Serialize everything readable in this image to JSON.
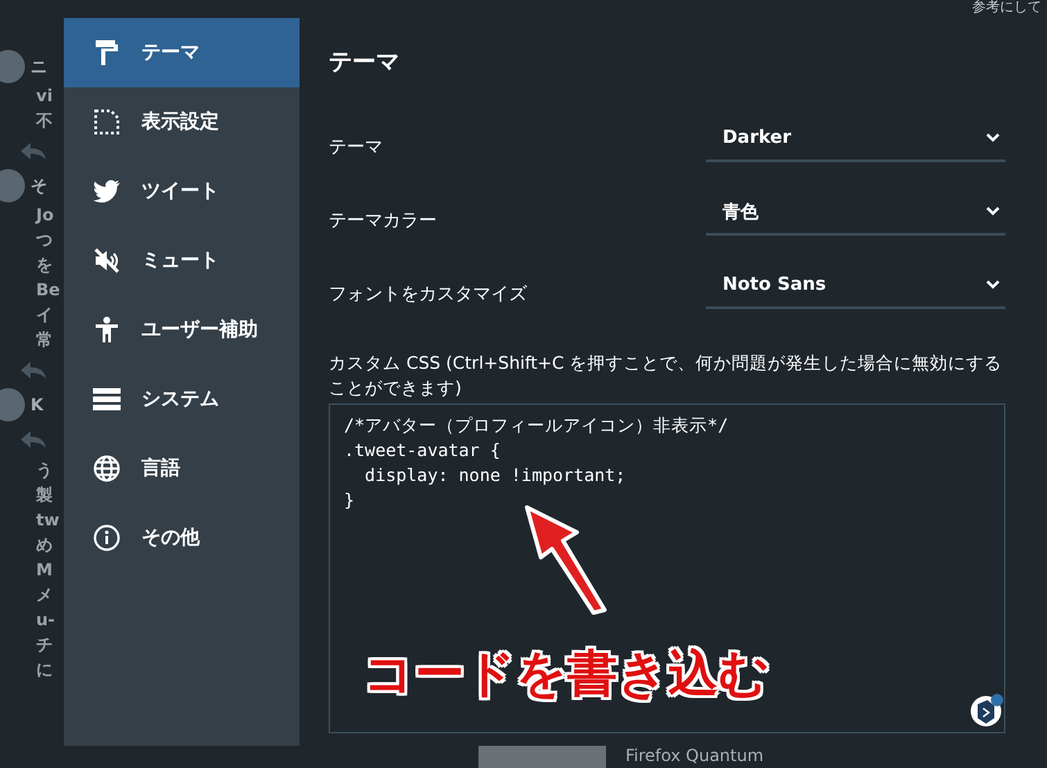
{
  "background": {
    "left_fragments": [
      {
        "kind": "gap"
      },
      {
        "kind": "name",
        "text": "ニ"
      },
      {
        "kind": "text",
        "text": "vi"
      },
      {
        "kind": "text",
        "text": "不"
      },
      {
        "kind": "reply"
      },
      {
        "kind": "name",
        "text": "そ"
      },
      {
        "kind": "text",
        "text": "Jo"
      },
      {
        "kind": "text",
        "text": "つ"
      },
      {
        "kind": "text",
        "text": "を"
      },
      {
        "kind": "text",
        "text": "Be"
      },
      {
        "kind": "text",
        "text": "イ"
      },
      {
        "kind": "text",
        "text": "常"
      },
      {
        "kind": "reply"
      },
      {
        "kind": "name",
        "text": "K"
      },
      {
        "kind": "reply"
      },
      {
        "kind": "text",
        "text": "う"
      },
      {
        "kind": "text",
        "text": "製"
      },
      {
        "kind": "text",
        "text": "tw"
      },
      {
        "kind": "text",
        "text": "め"
      },
      {
        "kind": "text",
        "text": "M"
      },
      {
        "kind": "text",
        "text": "メ"
      },
      {
        "kind": "text",
        "text": "u-"
      },
      {
        "kind": "text",
        "text": "チ"
      },
      {
        "kind": "text",
        "text": "に"
      }
    ],
    "top_right": "参考にして",
    "bottom_card": "Firefox Quantum"
  },
  "settings": {
    "sidebar": [
      {
        "label": "テーマ",
        "kind": "roller",
        "selected": true
      },
      {
        "label": "表示設定",
        "kind": "frame",
        "selected": false
      },
      {
        "label": "ツイート",
        "kind": "bird",
        "selected": false
      },
      {
        "label": "ミュート",
        "kind": "mute",
        "selected": false
      },
      {
        "label": "ユーザー補助",
        "kind": "person",
        "selected": false
      },
      {
        "label": "システム",
        "kind": "server",
        "selected": false
      },
      {
        "label": "言語",
        "kind": "globe",
        "selected": false
      },
      {
        "label": "その他",
        "kind": "info",
        "selected": false
      }
    ],
    "title": "テーマ",
    "fields": [
      {
        "label": "テーマ",
        "value": "Darker"
      },
      {
        "label": "テーマカラー",
        "value": "青色"
      },
      {
        "label": "フォントをカスタマイズ",
        "value": "Noto Sans"
      }
    ],
    "custom_css": {
      "label": "カスタム CSS (Ctrl+Shift+C を押すことで、何か問題が発生した場合に無効にすることができます)",
      "value": "/*アバター（プロフィールアイコン）非表示*/\n.tweet-avatar {\n  display: none !important;\n}"
    }
  },
  "annotation": {
    "text": "コードを書き込む"
  }
}
